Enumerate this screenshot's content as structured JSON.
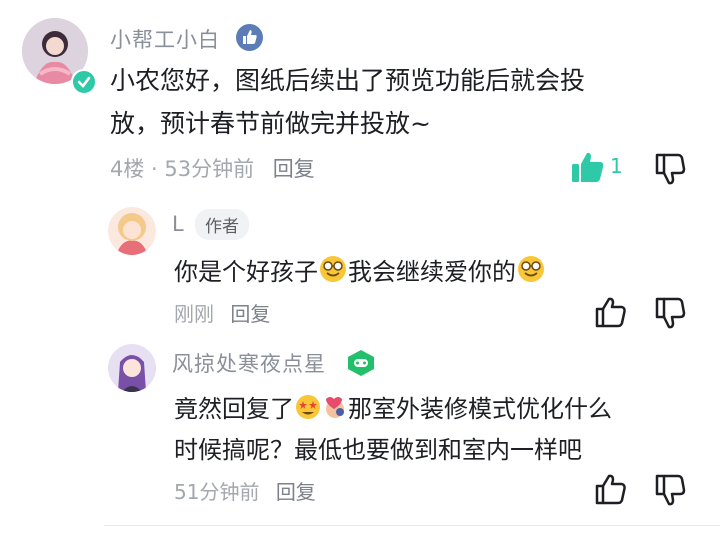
{
  "comments": [
    {
      "author": "小帮工小白",
      "text_line1": "小农您好，图纸后续出了预览功能后就会投",
      "text_line2": "放，预计春节前做完并投放~",
      "meta": "4楼 · 53分钟前",
      "reply_label": "回复",
      "like_count": "1",
      "icons": [
        "verified-badge-icon",
        "thumb-up-filled-icon",
        "thumb-down-icon"
      ],
      "colors": {
        "accent": "#2ec9a6",
        "verified": "#5b7cb5"
      }
    },
    {
      "author": "L",
      "author_badge": "作者",
      "text_before": "你是个好孩子",
      "text_after": "我会继续爱你的",
      "meta": "刚刚",
      "reply_label": "回复",
      "icons": [
        "glasses-smile-emoji-icon",
        "thumb-up-icon",
        "thumb-down-icon"
      ]
    },
    {
      "author": "风掠处寒夜点星",
      "text_line1_after": "那室外装修模式优化什么",
      "text_line1_before": "竟然回复了",
      "text_line2": "时候搞呢？最低也要做到和室内一样吧",
      "meta": "51分钟前",
      "reply_label": "回复",
      "icons": [
        "gamepad-badge-icon",
        "starstruck-emoji-icon",
        "kiss-emoji-icon",
        "thumb-up-icon",
        "thumb-down-icon"
      ]
    }
  ]
}
